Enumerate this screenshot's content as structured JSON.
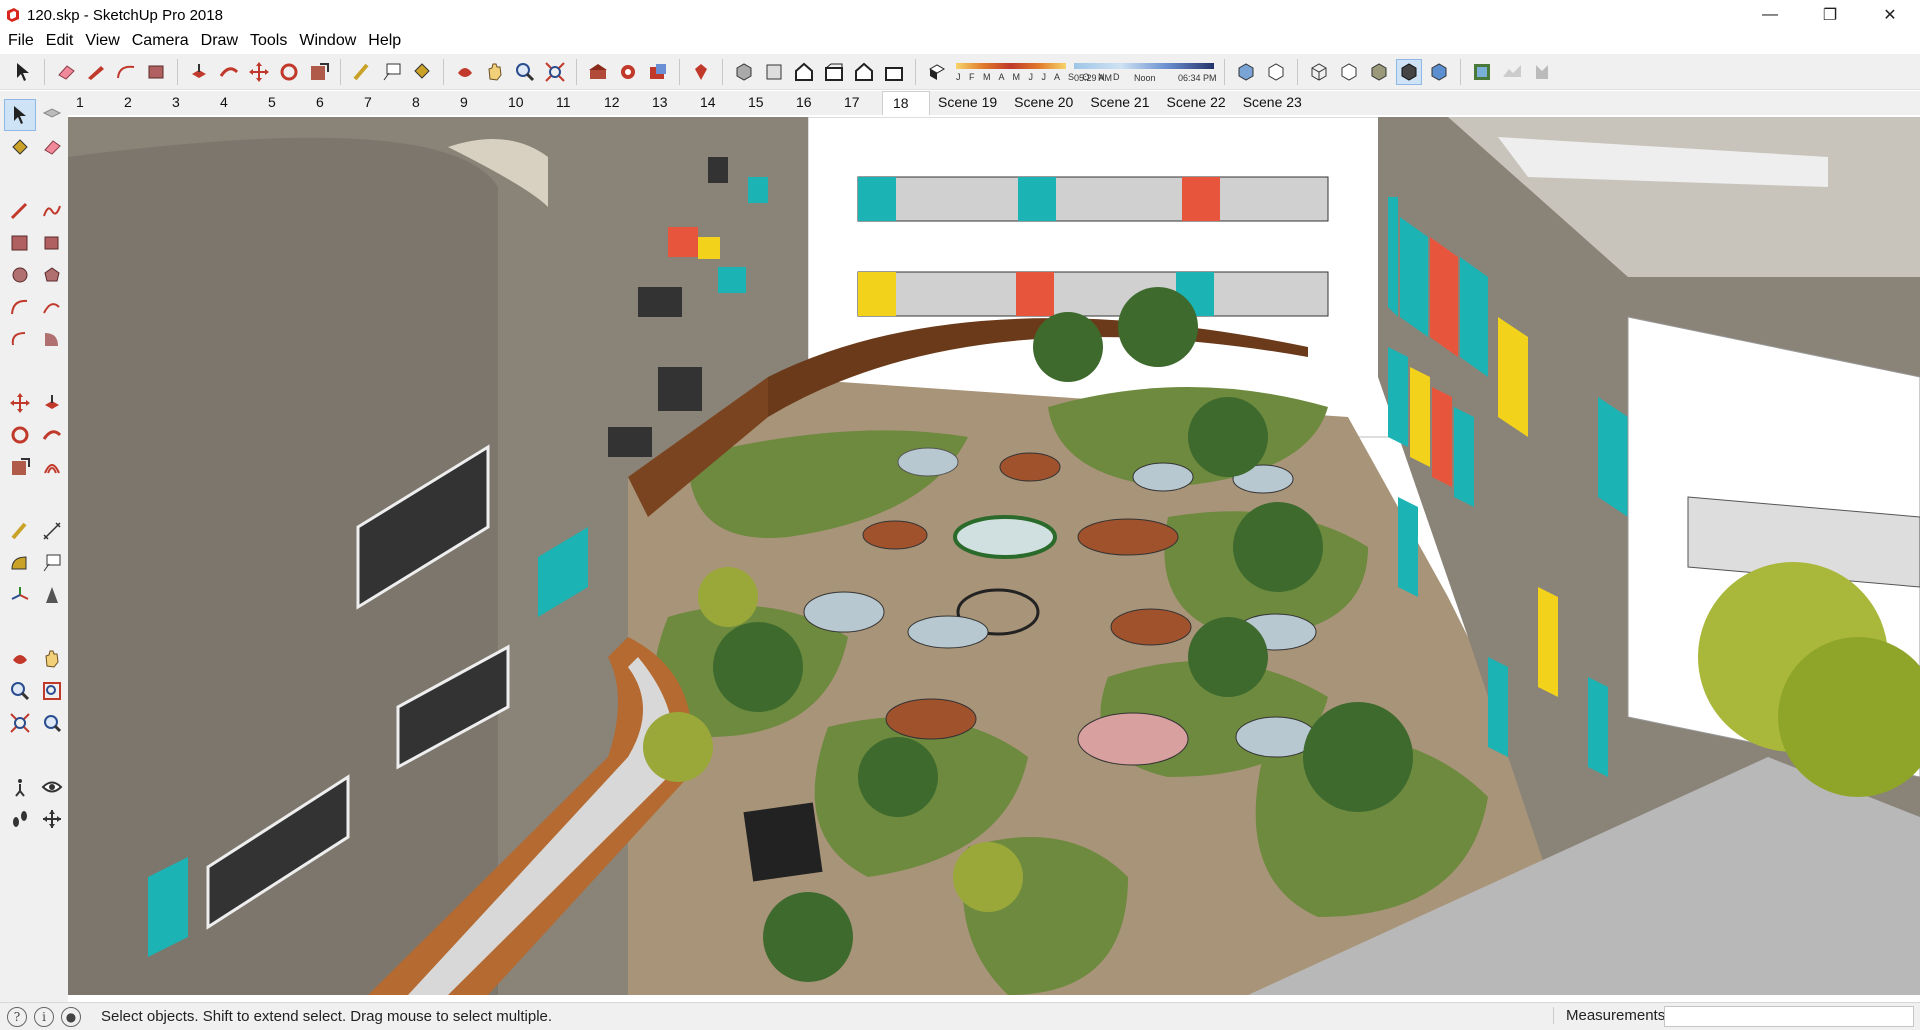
{
  "window": {
    "title": "120.skp - SketchUp Pro 2018",
    "controls": {
      "minimize": "—",
      "maximize": "❐",
      "close": "✕"
    }
  },
  "menu": [
    "File",
    "Edit",
    "View",
    "Camera",
    "Draw",
    "Tools",
    "Window",
    "Help"
  ],
  "toolbar": {
    "shadow_months": "J F M A M J J A S O N D",
    "time_start": "05:29 AM",
    "time_mid": "Noon",
    "time_end": "06:34 PM"
  },
  "scenes": {
    "numbered": [
      "1",
      "2",
      "3",
      "4",
      "5",
      "6",
      "7",
      "8",
      "9",
      "10",
      "11",
      "12",
      "13",
      "14",
      "15",
      "16",
      "17",
      "18"
    ],
    "named": [
      "Scene 19",
      "Scene 20",
      "Scene 21",
      "Scene 22",
      "Scene 23"
    ],
    "active": "18"
  },
  "status": {
    "hint": "Select objects. Shift to extend select. Drag mouse to select multiple.",
    "measurements_label": "Measurements",
    "measurements_value": ""
  },
  "colors": {
    "accent_teal": "#1bb3b3",
    "accent_red": "#e8553d",
    "accent_yellow": "#f2d21a",
    "building_gray": "#8a8378",
    "lawn_green": "#6d8a3e",
    "gravel": "#a89478"
  }
}
